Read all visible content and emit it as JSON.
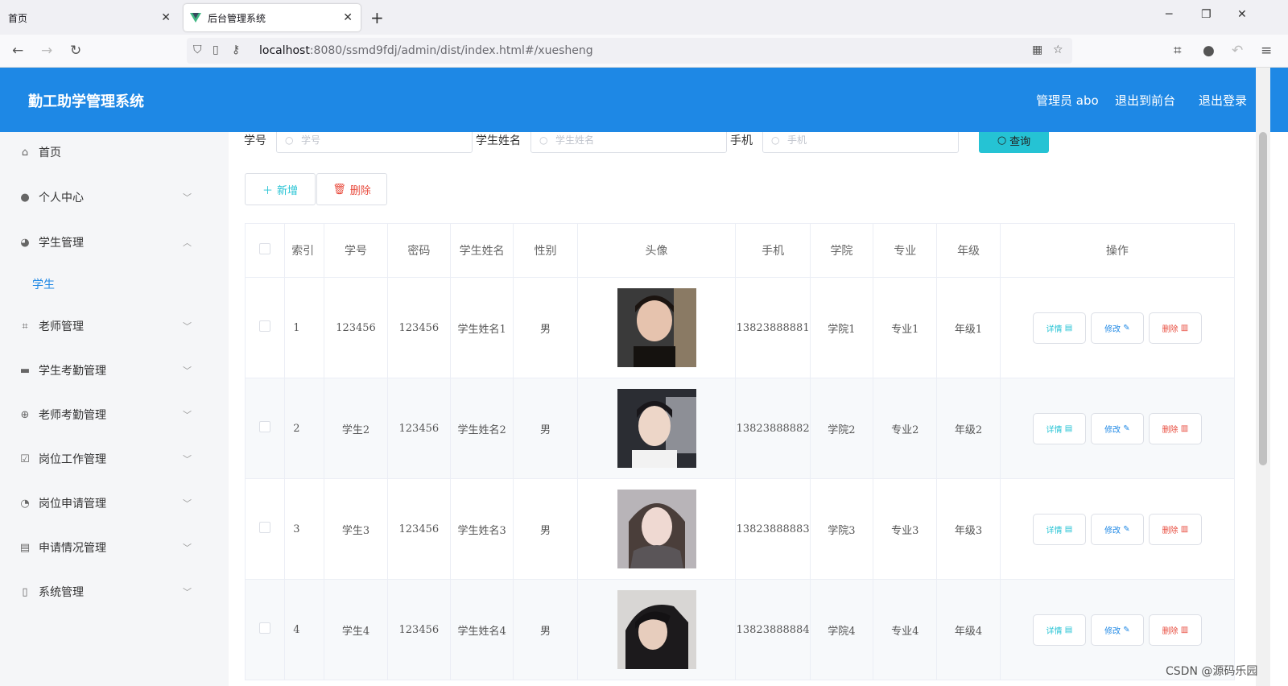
{
  "browser": {
    "tabs": [
      {
        "label": "首页"
      },
      {
        "label": "后台管理系统"
      }
    ],
    "url_host": "localhost",
    "url_path": ":8080/ssmd9fdj/admin/dist/index.html#/xuesheng"
  },
  "header": {
    "title": "勤工助学管理系统",
    "user": "管理员 abo",
    "to_front": "退出到前台",
    "logout": "退出登录"
  },
  "sidebar": {
    "items": [
      {
        "label": "首页",
        "icon": "home-icon"
      },
      {
        "label": "个人中心",
        "icon": "user-icon"
      },
      {
        "label": "学生管理",
        "icon": "bulb-icon"
      },
      {
        "label": "学生",
        "icon": ""
      },
      {
        "label": "老师管理",
        "icon": "crop-icon"
      },
      {
        "label": "学生考勤管理",
        "icon": "briefcase-icon"
      },
      {
        "label": "老师考勤管理",
        "icon": "crosshair-icon"
      },
      {
        "label": "岗位工作管理",
        "icon": "clipboard-check-icon"
      },
      {
        "label": "岗位申请管理",
        "icon": "compass-icon"
      },
      {
        "label": "申请情况管理",
        "icon": "clipboard-icon"
      },
      {
        "label": "系统管理",
        "icon": "phone-icon"
      }
    ]
  },
  "search": {
    "student_no_label": "学号",
    "student_no_placeholder": "学号",
    "name_label": "学生姓名",
    "name_placeholder": "学生姓名",
    "phone_label": "手机",
    "phone_placeholder": "手机",
    "query_label": "查询"
  },
  "actions": {
    "add": "新增",
    "delete": "删除"
  },
  "table": {
    "headers": [
      "索引",
      "学号",
      "密码",
      "学生姓名",
      "性别",
      "头像",
      "手机",
      "学院",
      "专业",
      "年级",
      "操作"
    ],
    "rows": [
      {
        "index": "1",
        "no": "123456",
        "password": "123456",
        "name": "学生姓名1",
        "gender": "男",
        "phone": "13823888881",
        "college": "学院1",
        "major": "专业1",
        "grade": "年级1"
      },
      {
        "index": "2",
        "no": "学生2",
        "password": "123456",
        "name": "学生姓名2",
        "gender": "男",
        "phone": "13823888882",
        "college": "学院2",
        "major": "专业2",
        "grade": "年级2"
      },
      {
        "index": "3",
        "no": "学生3",
        "password": "123456",
        "name": "学生姓名3",
        "gender": "男",
        "phone": "13823888883",
        "college": "学院3",
        "major": "专业3",
        "grade": "年级3"
      },
      {
        "index": "4",
        "no": "学生4",
        "password": "123456",
        "name": "学生姓名4",
        "gender": "男",
        "phone": "13823888884",
        "college": "学院4",
        "major": "专业4",
        "grade": "年级4"
      }
    ],
    "op_detail": "详情",
    "op_edit": "修改",
    "op_delete": "删除"
  },
  "watermark": "CSDN @源码乐园",
  "colors": {
    "header": "#1e88e5",
    "accent": "#25c3d4",
    "danger": "#e84a3c"
  }
}
